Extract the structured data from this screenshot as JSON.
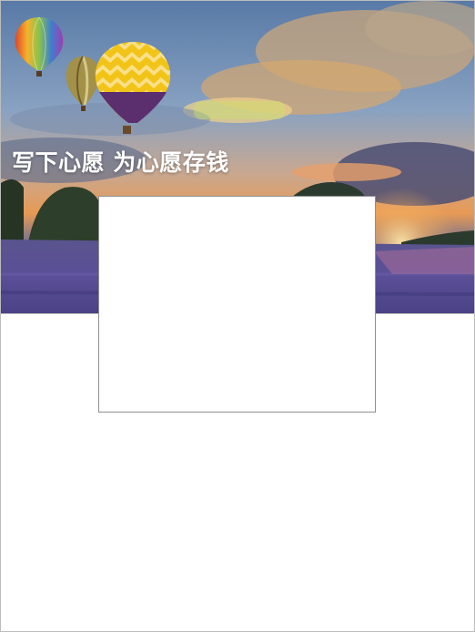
{
  "banner": {
    "title": "写下心愿 为心愿存钱"
  },
  "icons": [
    "hot-air-balloon-icon"
  ],
  "colors": {
    "title_text": "#ffffff",
    "dialog_border": "#8f8f8f",
    "background": "#ffffff"
  }
}
